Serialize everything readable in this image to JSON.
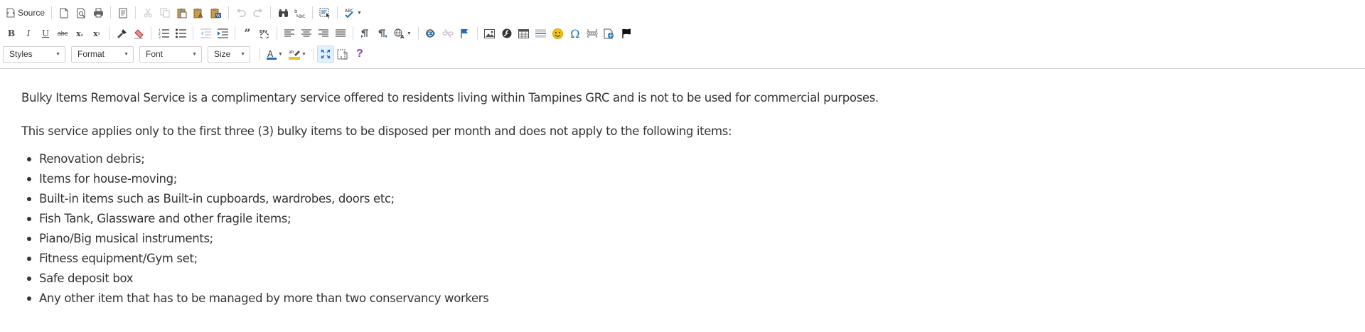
{
  "toolbar": {
    "source_label": "Source",
    "styles_label": "Styles",
    "format_label": "Format",
    "font_label": "Font",
    "size_label": "Size",
    "strike_glyph": "abc",
    "spell_glyph": "ABC",
    "colors": {
      "accent": "#1e6fb8",
      "highlight": "#f0c020",
      "smiley": "#f4c20d",
      "help": "#8a3fbf"
    }
  },
  "document": {
    "paragraphs": [
      "Bulky Items Removal Service is a complimentary service offered to residents living within Tampines GRC and is not to be used for commercial purposes.",
      "This service applies only to the first three (3) bulky items to be disposed per month and does not apply to the following items:"
    ],
    "items": [
      "Renovation debris;",
      "Items for house-moving;",
      "Built-in items such as Built-in cupboards, wardrobes, doors etc;",
      "Fish Tank, Glassware and other fragile items;",
      "Piano/Big musical instruments;",
      "Fitness equipment/Gym set;",
      "Safe deposit box",
      "Any other item that has to be managed by more than two conservancy workers"
    ]
  }
}
